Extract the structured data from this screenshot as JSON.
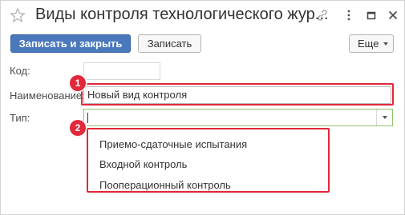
{
  "window": {
    "title": "Виды контроля технологического жур...",
    "icons": [
      "star-icon",
      "link-icon",
      "more-icon",
      "maximize-icon",
      "close-icon"
    ]
  },
  "toolbar": {
    "save_close_label": "Записать и закрыть",
    "save_label": "Записать",
    "more_label": "Еще"
  },
  "form": {
    "code_label": "Код:",
    "code_value": "",
    "name_label": "Наименование:",
    "name_value": "Новый вид контроля",
    "type_label": "Тип:",
    "type_value": ""
  },
  "dropdown": {
    "options": [
      "Приемо-сдаточные испытания",
      "Входной контроль",
      "Пооперационный контроль"
    ]
  },
  "annotations": {
    "badge_1": "1",
    "badge_2": "2",
    "highlight_color": "#e2283a"
  },
  "colors": {
    "primary_button": "#4a78bd",
    "active_field_border": "#8dc26a"
  }
}
